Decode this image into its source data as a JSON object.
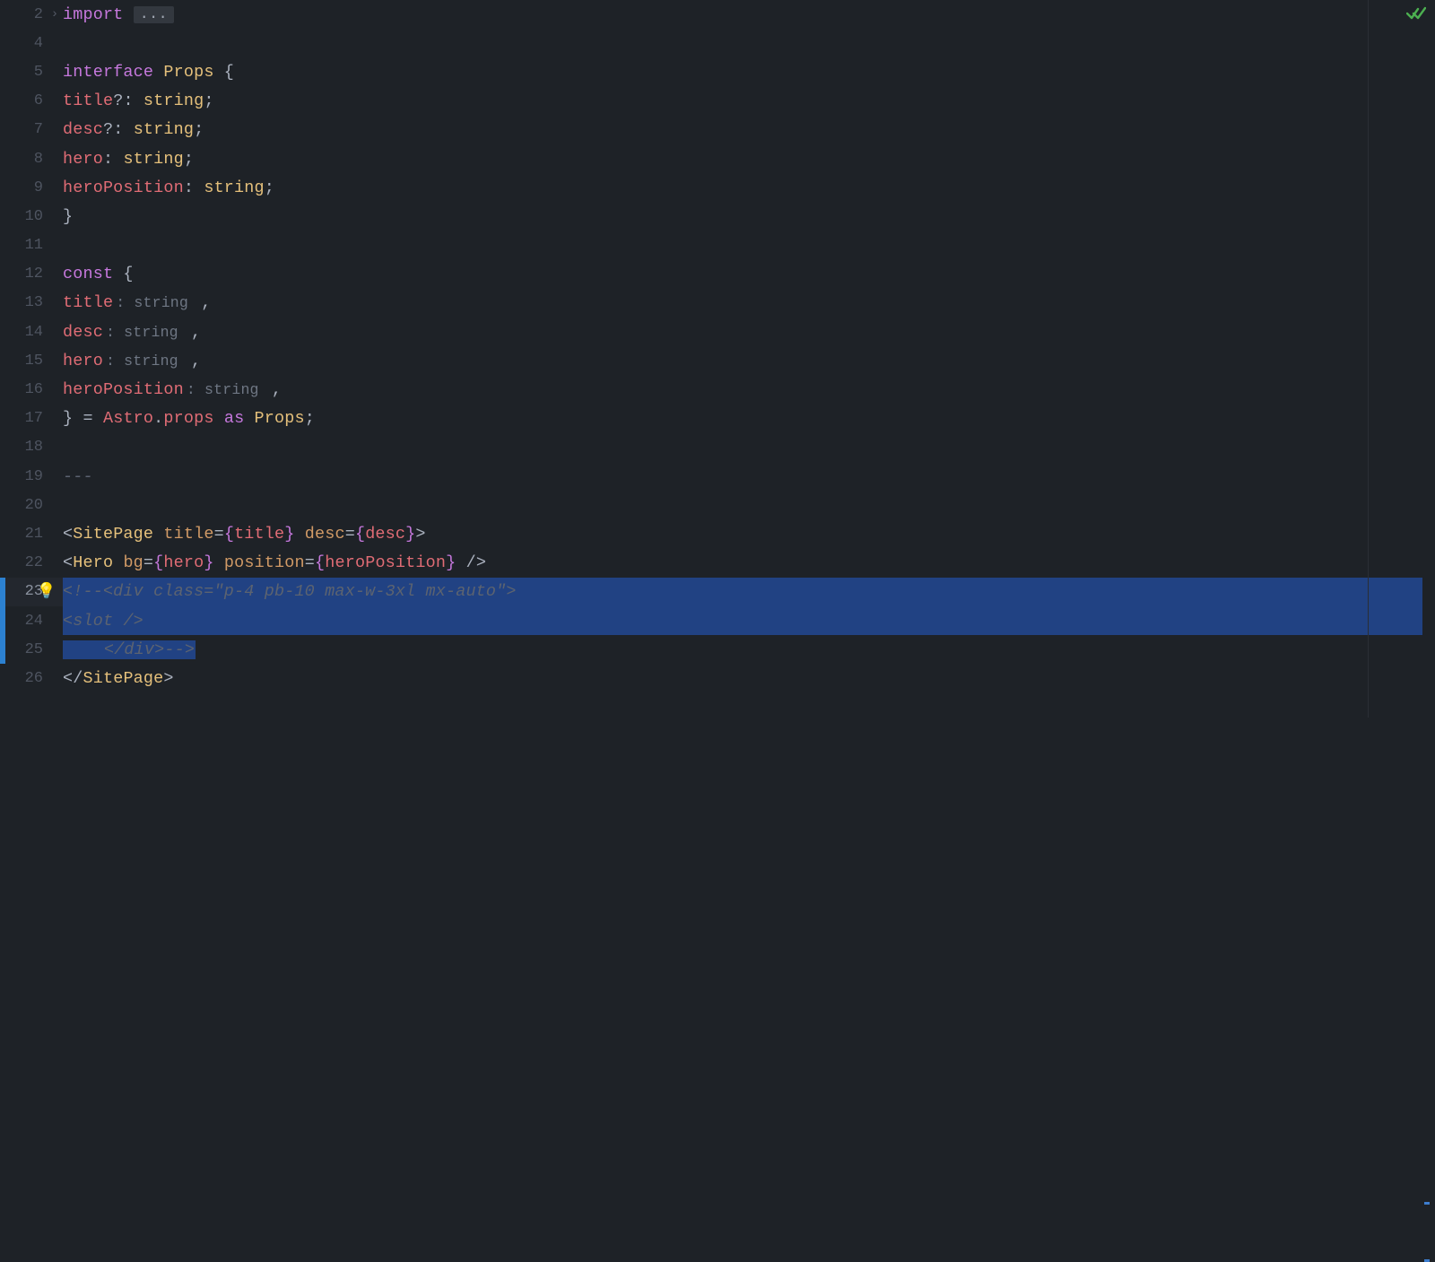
{
  "gutter": {
    "numbers": [
      "2",
      "4",
      "5",
      "6",
      "7",
      "8",
      "9",
      "10",
      "11",
      "12",
      "13",
      "14",
      "15",
      "16",
      "17",
      "18",
      "19",
      "20",
      "21",
      "22",
      "23",
      "24",
      "25",
      "26"
    ],
    "active_line": "23"
  },
  "bulb": "💡",
  "check": "✓✓",
  "fold_collapsed": "›",
  "collapse": "...",
  "tokens": {
    "import": "import ",
    "interface": "interface ",
    "Props": "Props",
    "lbrace": " {",
    "rbrace": "}",
    "title_opt": "title",
    "qmark": "?",
    "colon": ": ",
    "string": "string",
    "semi": ";",
    "desc_opt": "desc",
    "hero": "hero",
    "heroPosition": "heroPosition",
    "const": "const",
    "comma": " ,",
    "eq": " = ",
    "Astro": "Astro",
    "dot": ".",
    "props": "props",
    "as": " as ",
    "semi2": ";",
    "frontmatter": "---",
    "SitePage": "SitePage",
    "lt": "<",
    "gt": ">",
    "slash": "/",
    "attr_title": " title",
    "assign": "=",
    "lcb": "{",
    "rcb": "}",
    "attr_desc": " desc",
    "close_self": " />",
    "Hero": "Hero",
    "bg": " bg",
    "position": " position",
    "cm1": "<!--<div class=\"p-4 pb-10 max-w-3xl mx-auto\">",
    "cm2": "<slot />",
    "cm3": "</div>-->",
    "close_site": "SitePage"
  },
  "inlay": {
    "colon_string": ": string"
  }
}
